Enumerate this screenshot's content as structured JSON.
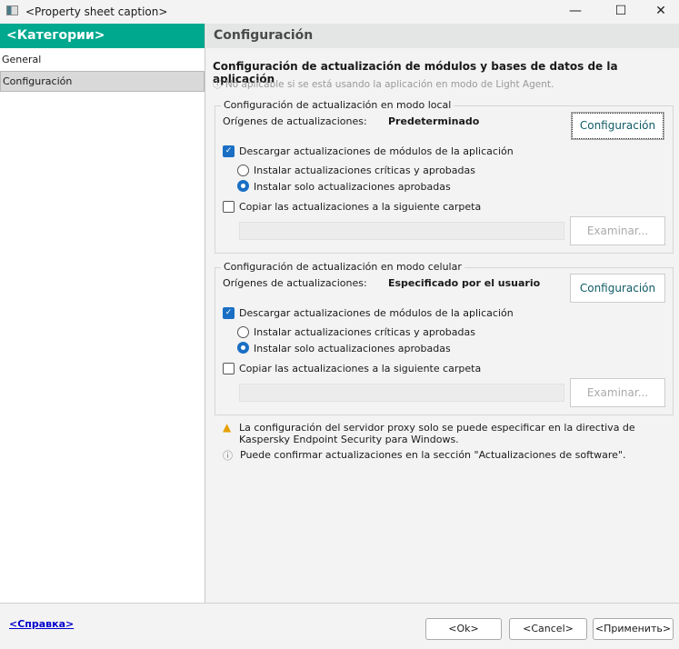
{
  "window": {
    "title": "<Property sheet caption>",
    "minimize": "—",
    "maximize": "☐",
    "close": "✕"
  },
  "sidebar": {
    "header": "<Категории>",
    "items": [
      {
        "label": "General"
      },
      {
        "label": "Configuración"
      }
    ]
  },
  "main": {
    "header": "Configuración",
    "title": "Configuración de actualización de módulos y bases de datos de la aplicación",
    "subtitle": "No aplicable si se está usando la aplicación en modo de Light Agent.",
    "groups": [
      {
        "legend": "Configuración de actualización en modo local",
        "sources_label": "Orígenes de actualizaciones:",
        "sources_value": "Predeterminado",
        "config_button": "Configuración",
        "download_label": "Descargar actualizaciones de módulos de la aplicación",
        "download_checked": true,
        "radio1": "Instalar actualizaciones críticas y aprobadas",
        "radio2": "Instalar solo actualizaciones aprobadas",
        "selected_radio": 2,
        "copy_label": "Copiar las actualizaciones a la siguiente carpeta",
        "copy_checked": false,
        "folder_value": "",
        "browse_button": "Examinar..."
      },
      {
        "legend": "Configuración de actualización en modo celular",
        "sources_label": "Orígenes de actualizaciones:",
        "sources_value": "Especificado por el usuario",
        "config_button": "Configuración",
        "download_label": "Descargar actualizaciones de módulos de la aplicación",
        "download_checked": true,
        "radio1": "Instalar actualizaciones críticas y aprobadas",
        "radio2": "Instalar solo actualizaciones aprobadas",
        "selected_radio": 2,
        "copy_label": "Copiar las actualizaciones a la siguiente carpeta",
        "copy_checked": false,
        "folder_value": "",
        "browse_button": "Examinar..."
      }
    ],
    "warning": "La configuración del servidor proxy solo se puede especificar en la directiva de Kaspersky Endpoint Security para Windows.",
    "info": "Puede confirmar actualizaciones en la sección \"Actualizaciones de software\"."
  },
  "footer": {
    "help": "<Справка>",
    "ok": "<Ok>",
    "cancel": "<Cancel>",
    "apply": "<Применить>"
  },
  "colors": {
    "accent": "#00a88e",
    "checkbox": "#1a6fc4"
  }
}
